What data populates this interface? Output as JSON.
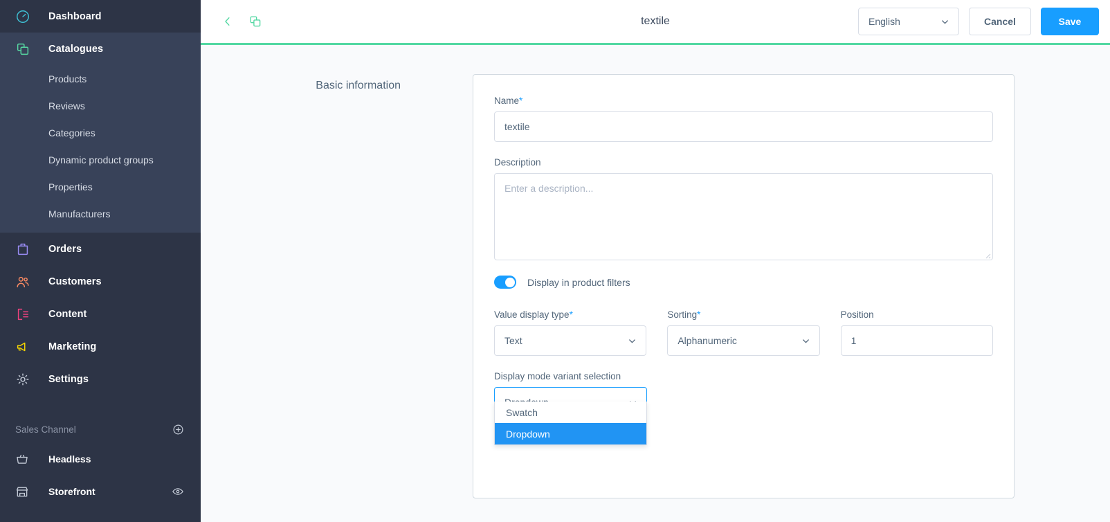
{
  "sidebar": {
    "main_items": [
      {
        "label": "Dashboard",
        "icon": "dashboard-icon",
        "color": "#3ec0d4"
      },
      {
        "label": "Catalogues",
        "icon": "catalogues-icon",
        "color": "#57d9a3",
        "active": true
      }
    ],
    "catalogue_subitems": [
      {
        "label": "Products"
      },
      {
        "label": "Reviews"
      },
      {
        "label": "Categories"
      },
      {
        "label": "Dynamic product groups"
      },
      {
        "label": "Properties"
      },
      {
        "label": "Manufacturers"
      }
    ],
    "lower_items": [
      {
        "label": "Orders",
        "icon": "orders-icon",
        "color": "#9a8cf5"
      },
      {
        "label": "Customers",
        "icon": "customers-icon",
        "color": "#f88962"
      },
      {
        "label": "Content",
        "icon": "content-icon",
        "color": "#f0427f"
      },
      {
        "label": "Marketing",
        "icon": "marketing-icon",
        "color": "#f5d500"
      },
      {
        "label": "Settings",
        "icon": "settings-gear-icon",
        "color": "#c5ccd8"
      }
    ],
    "sales_channel": {
      "heading": "Sales Channel",
      "add_icon": "plus-circle-icon",
      "items": [
        {
          "label": "Headless",
          "icon": "basket-icon",
          "has_preview": false
        },
        {
          "label": "Storefront",
          "icon": "storefront-icon",
          "has_preview": true,
          "preview_icon": "eye-icon"
        }
      ]
    }
  },
  "topbar": {
    "back_icon": "chevron-left-icon",
    "duplicate_icon": "duplicate-icon",
    "title": "textile",
    "language": {
      "value": "English",
      "chevron": "chevron-down-icon"
    },
    "cancel_label": "Cancel",
    "save_label": "Save"
  },
  "content": {
    "section_title": "Basic information",
    "name_field": {
      "label": "Name",
      "required_mark": "*",
      "value": "textile"
    },
    "description_field": {
      "label": "Description",
      "placeholder": "Enter a description...",
      "value": ""
    },
    "display_filters_toggle": {
      "label": "Display in product filters",
      "state": "on"
    },
    "value_display_type": {
      "label": "Value display type",
      "required_mark": "*",
      "value": "Text"
    },
    "sorting": {
      "label": "Sorting",
      "required_mark": "*",
      "value": "Alphanumeric"
    },
    "position": {
      "label": "Position",
      "value": "1"
    },
    "display_mode_variant": {
      "label": "Display mode variant selection",
      "value": "Dropdown",
      "open": true,
      "options": [
        {
          "label": "Swatch",
          "selected": false
        },
        {
          "label": "Dropdown",
          "selected": true
        }
      ]
    }
  },
  "colors": {
    "sidebar_bg": "#2d3446",
    "sidebar_group_bg": "#384259",
    "accent_green": "#54d8a3",
    "accent_blue": "#189eff",
    "highlight_blue": "#2194f3",
    "page_bg": "#f9fafc"
  }
}
